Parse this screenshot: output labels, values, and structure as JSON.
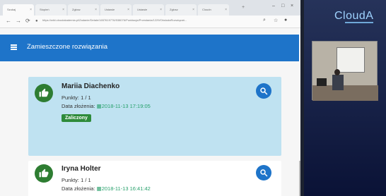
{
  "browser": {
    "tabs": [
      {
        "label": "Szukaj"
      },
      {
        "label": "Stopień"
      },
      {
        "label": "Zgłosz"
      },
      {
        "label": "Ustawie"
      },
      {
        "label": "Ustawie"
      },
      {
        "label": "Zgłosz"
      },
      {
        "label": "Cloudn"
      }
    ],
    "url": "https://wiki.cloudakademia.pl/Zadanie/Detale/1657619776/538076/Punktacja/Przesłania/1229/ObsłudaRozwiązań..."
  },
  "header": {
    "title": "Zamieszczone rozwiązania"
  },
  "submissions": [
    {
      "name": "Mariia Diachenko",
      "points": "Punkty: 1 / 1",
      "date_label": "Data złożenia:",
      "date": "2018-11-13 17:19:05",
      "status": "Zaliczony"
    },
    {
      "name": "Iryna Holter",
      "points": "Punkty: 1 / 1",
      "date_label": "Data złożenia:",
      "date": "2018-11-13 16:41:42"
    }
  ],
  "stage": {
    "logo": "CloudA"
  },
  "icons": {
    "menu": "hamburger-icon",
    "thumb": "thumbs-up-icon",
    "search": "search-icon",
    "calendar": "calendar-icon"
  },
  "colors": {
    "primary": "#1e74c9",
    "approved": "#2e7d32",
    "highlight_row": "#bfe2f1",
    "date": "#27a06b"
  }
}
